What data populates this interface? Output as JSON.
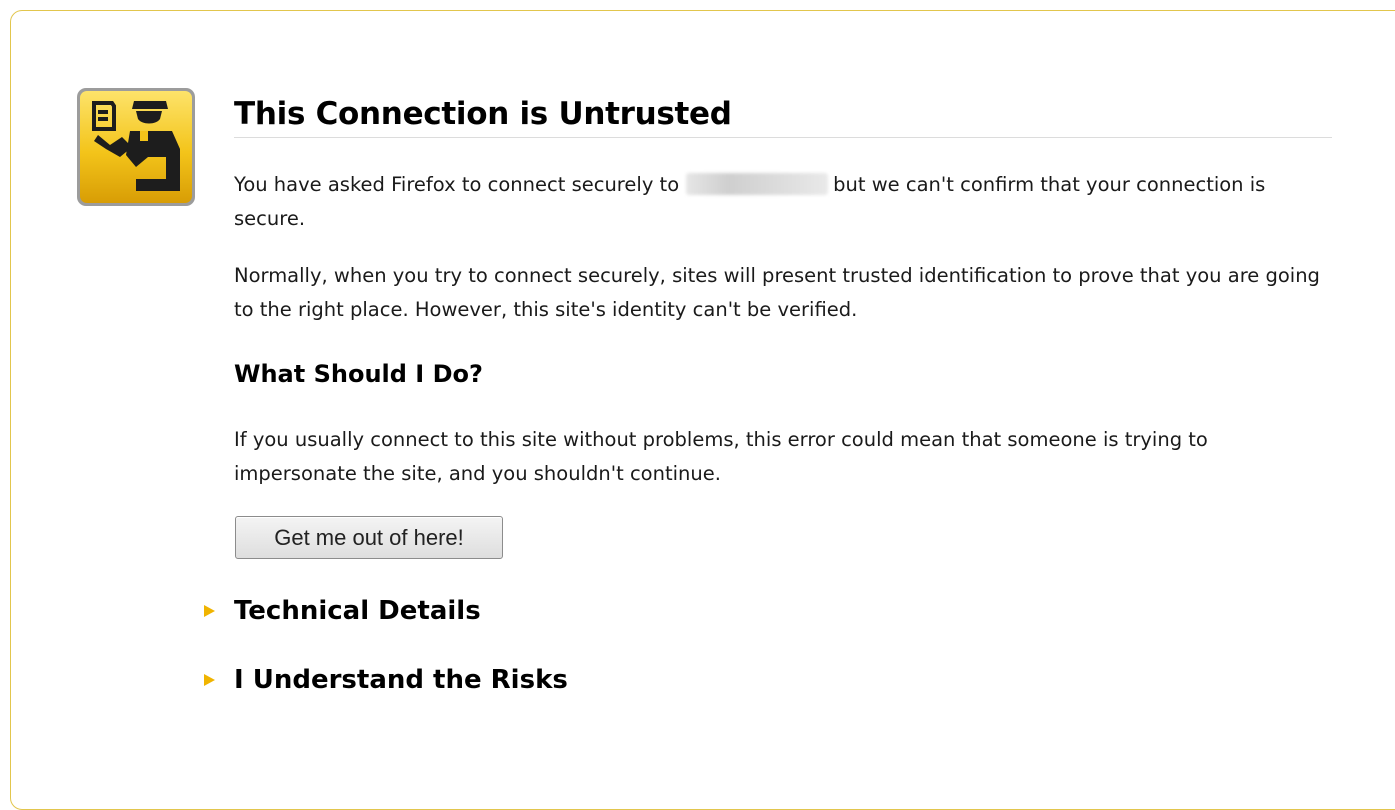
{
  "page": {
    "title": "This Connection is Untrusted",
    "intro_before_host": "You have asked Firefox to connect securely to",
    "intro_after_host": "but we can't confirm that your connection is secure.",
    "explanation": "Normally, when you try to connect securely, sites will present trusted identification to prove that you are going to the right place. However, this site's identity can't be verified.",
    "what_to_do_heading": "What Should I Do?",
    "what_to_do_text": "If you usually connect to this site without problems, this error could mean that someone is trying to impersonate the site, and you shouldn't continue.",
    "get_out_button": "Get me out of here!",
    "technical_details": "Technical Details",
    "understand_risks": "I Understand the Risks"
  },
  "icons": {
    "header_icon": "certificate-officer-icon",
    "expander_arrow": "triangle-right-icon"
  },
  "colors": {
    "icon_yellow": "#f5c518",
    "frame_border": "#e2c64d",
    "expander_arrow": "#f0b400"
  }
}
